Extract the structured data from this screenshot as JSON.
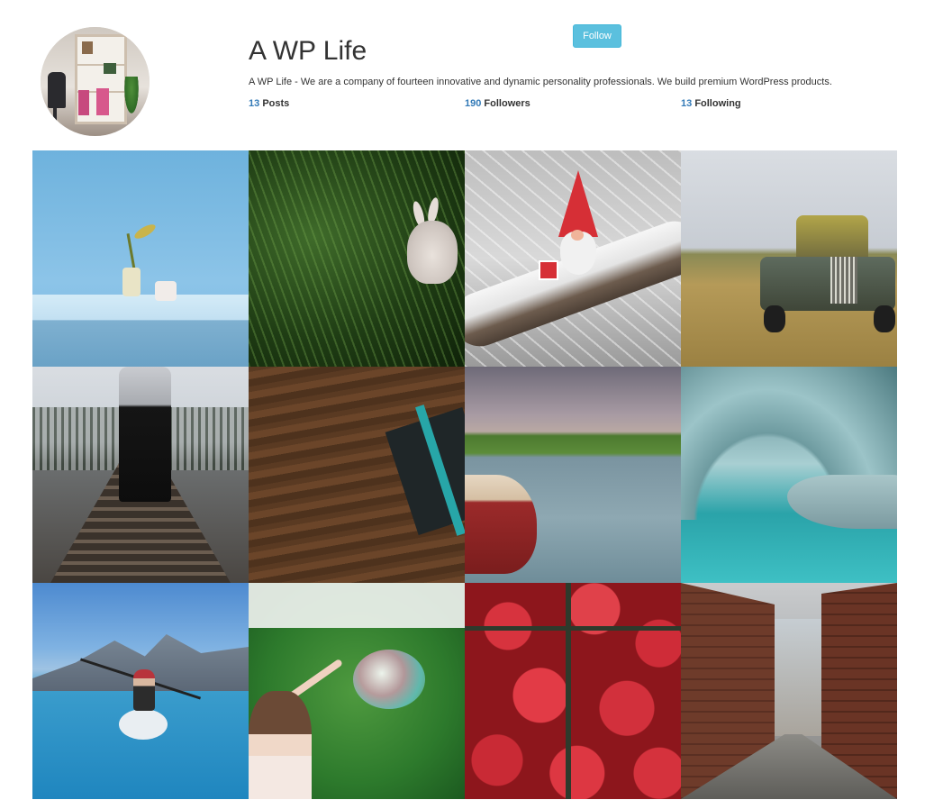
{
  "profile": {
    "name": "A WP Life",
    "bio": "A WP Life - We are a company of fourteen innovative and dynamic personality professionals. We build premium WordPress products.",
    "follow_label": "Follow",
    "stats": {
      "posts": {
        "count": "13",
        "label": "Posts"
      },
      "followers": {
        "count": "190",
        "label": "Followers"
      },
      "following": {
        "count": "13",
        "label": "Following"
      }
    }
  },
  "colors": {
    "follow_button": "#5bc0de",
    "stat_number": "#337ab7"
  }
}
